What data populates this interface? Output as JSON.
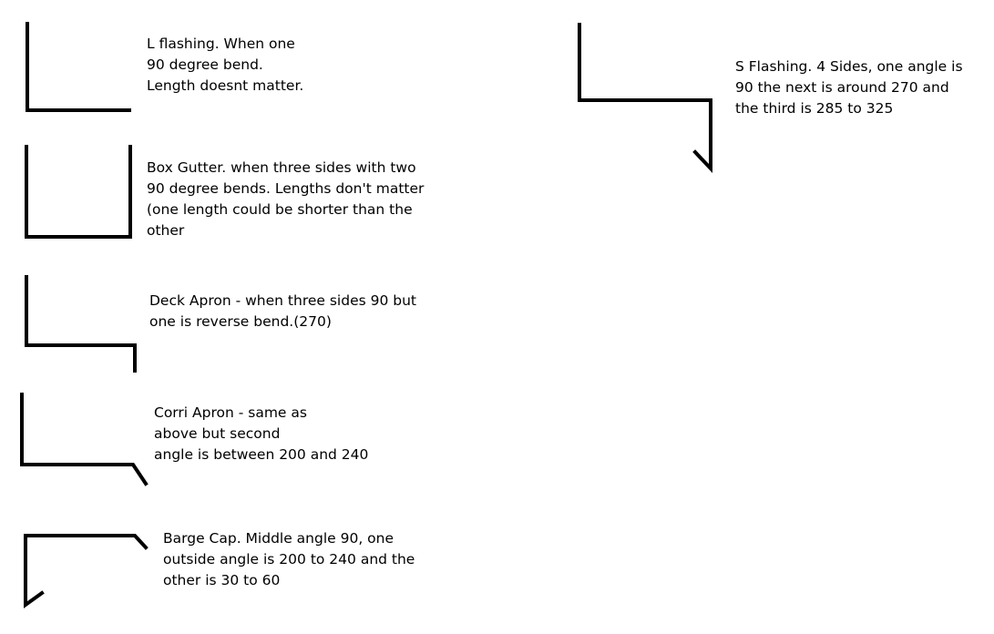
{
  "shapes": [
    {
      "name": "l-flashing",
      "lines": [
        "L flashing. When one",
        "90 degree bend.",
        "Length doesnt matter."
      ]
    },
    {
      "name": "box-gutter",
      "lines": [
        "Box Gutter. when three sides with two",
        "90 degree bends. Lengths don't matter",
        "(one length could be shorter than the",
        "other"
      ]
    },
    {
      "name": "deck-apron",
      "lines": [
        "Deck Apron - when three sides 90 but",
        "one is reverse bend.(270)"
      ]
    },
    {
      "name": "corri-apron",
      "lines": [
        "Corri Apron - same as",
        "above but second",
        "angle is between 200 and 240"
      ]
    },
    {
      "name": "barge-cap",
      "lines": [
        "Barge Cap. Middle angle 90, one",
        "outside angle is 200 to 240 and the",
        "other is 30 to 60"
      ]
    },
    {
      "name": "s-flashing",
      "lines": [
        "S Flashing. 4 Sides, one angle is",
        "90 the next is around 270 and",
        "the third is 285 to 325"
      ]
    }
  ],
  "stroke_color": "#000000"
}
